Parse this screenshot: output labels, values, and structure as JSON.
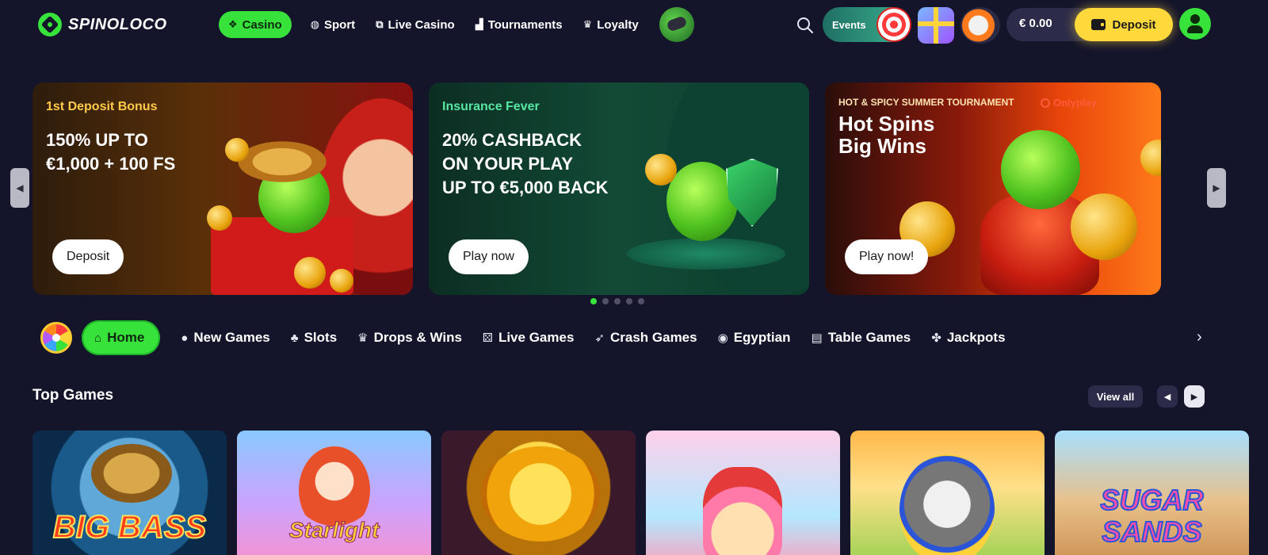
{
  "header": {
    "logo_text": "SPINOLOCO",
    "nav": [
      {
        "label": "Casino",
        "icon": "diamond-icon",
        "active": true
      },
      {
        "label": "Sport",
        "icon": "ball-icon",
        "active": false
      },
      {
        "label": "Live Casino",
        "icon": "cards-icon",
        "active": false
      },
      {
        "label": "Tournaments",
        "icon": "podium-icon",
        "active": false
      },
      {
        "label": "Loyalty",
        "icon": "crown-icon",
        "active": false
      }
    ],
    "events_label": "Events",
    "balance": "€ 0.00",
    "deposit_label": "Deposit"
  },
  "banners": [
    {
      "eyebrow": "1st Deposit Bonus",
      "title": "150% UP TO\n€1,000 + 100 FS",
      "cta": "Deposit"
    },
    {
      "eyebrow": "Insurance Fever",
      "title": "20% CASHBACK\nON YOUR PLAY\nUP TO €5,000 BACK",
      "cta": "Play now"
    },
    {
      "eyebrow": "HOT & SPICY SUMMER TOURNAMENT",
      "provider": "Onlyplay",
      "title": "Hot Spins\nBig Wins",
      "cta": "Play now!"
    }
  ],
  "carousel": {
    "total": 5,
    "active_index": 0
  },
  "categories": [
    {
      "label": "Home",
      "icon": "home-icon",
      "glyph": "⌂",
      "active": true
    },
    {
      "label": "New Games",
      "icon": "new-badge-icon",
      "glyph": "●",
      "active": false
    },
    {
      "label": "Slots",
      "icon": "cherries-icon",
      "glyph": "♣",
      "active": false
    },
    {
      "label": "Drops & Wins",
      "icon": "crown-icon",
      "glyph": "♛",
      "active": false
    },
    {
      "label": "Live Games",
      "icon": "dice-icon",
      "glyph": "⚄",
      "active": false
    },
    {
      "label": "Crash Games",
      "icon": "rocket-icon",
      "glyph": "➶",
      "active": false
    },
    {
      "label": "Egyptian",
      "icon": "eye-coin-icon",
      "glyph": "◉",
      "active": false
    },
    {
      "label": "Table Games",
      "icon": "cards-icon",
      "glyph": "▤",
      "active": false
    },
    {
      "label": "Jackpots",
      "icon": "clover-icon",
      "glyph": "✤",
      "active": false
    }
  ],
  "top_games": {
    "title": "Top Games",
    "view_all": "View all",
    "games": [
      {
        "name": "BIG BASS",
        "icon": "bass-fish-icon"
      },
      {
        "name": "Starlight",
        "icon": "princess-icon"
      },
      {
        "name": "",
        "icon": "gold-tree-icon"
      },
      {
        "name": "",
        "icon": "cake-icon"
      },
      {
        "name": "",
        "icon": "raccoon-pharaoh-icon"
      },
      {
        "name": "SUGAR\nSANDS",
        "icon": "pyramid-icon"
      }
    ]
  },
  "colors": {
    "background": "#14142b",
    "accent_green": "#37e23a",
    "deposit_yellow": "#ffd93b",
    "panel": "#2c2c4a"
  }
}
